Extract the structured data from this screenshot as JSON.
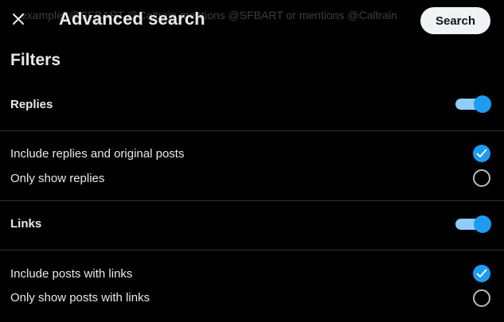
{
  "header": {
    "background_search_text": "example: @SFBART @Caltrain mentions @SFBART or mentions @Caltrain",
    "close_icon": "close-icon",
    "title": "Advanced search",
    "search_button_label": "Search"
  },
  "filters": {
    "heading": "Filters",
    "sections": [
      {
        "label": "Replies",
        "enabled": true,
        "options": [
          {
            "label": "Include replies and original posts",
            "selected": true
          },
          {
            "label": "Only show replies",
            "selected": false
          }
        ]
      },
      {
        "label": "Links",
        "enabled": true,
        "options": [
          {
            "label": "Include posts with links",
            "selected": true
          },
          {
            "label": "Only show posts with links",
            "selected": false
          }
        ]
      }
    ]
  },
  "colors": {
    "accent": "#1d9bf0",
    "toggle_track": "#8ecdf8",
    "background": "#000000",
    "text": "#e7e9ea",
    "divider": "#2f3336"
  }
}
